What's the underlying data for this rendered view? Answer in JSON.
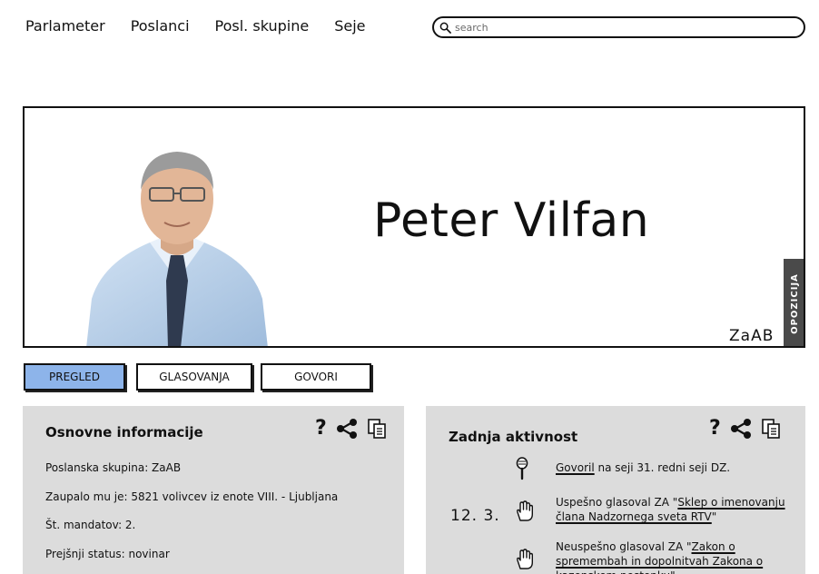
{
  "nav": {
    "items": [
      "Parlameter",
      "Poslanci",
      "Posl. skupine",
      "Seje"
    ],
    "search_placeholder": "search"
  },
  "hero": {
    "name": "Peter Vilfan",
    "party": "ZaAB",
    "badge": "OPOZICIJA"
  },
  "tabs": [
    {
      "label": "PREGLED",
      "active": true
    },
    {
      "label": "GLASOVANJA",
      "active": false
    },
    {
      "label": "GOVORI",
      "active": false
    }
  ],
  "basic_info": {
    "title": "Osnovne informacije",
    "lines": [
      "Poslanska skupina: ZaAB",
      "Zaupalo mu je: 5821 volivcev iz enote VIII. - Ljubljana",
      "Št. mandatov: 2.",
      "Prejšnji status: novinar"
    ]
  },
  "activity": {
    "title": "Zadnja aktivnost",
    "date": "12. 3.",
    "items": [
      {
        "icon": "microphone-icon",
        "link": "Govoril",
        "text": " na seji 31. redni seji DZ."
      },
      {
        "icon": "hand-vote-icon",
        "prefix": "Uspešno glasoval ZA \"",
        "link": "Sklep o imenovanju člana Nadzornega sveta RTV",
        "suffix": "\""
      },
      {
        "icon": "hand-vote-icon",
        "prefix": "Neuspešno glasoval ZA \"",
        "link": "Zakon o spremembah in dopolnitvah Zakona o kazenskem postopku",
        "suffix": "\""
      }
    ]
  },
  "tools": {
    "help": "?"
  },
  "colors": {
    "active_tab": "#8db4ea",
    "panel_bg": "#dcdcdc",
    "badge_bg": "#4a4a4a"
  }
}
